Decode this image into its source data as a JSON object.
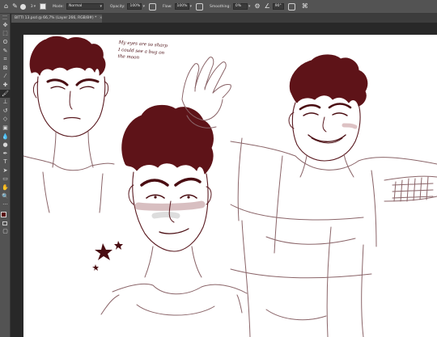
{
  "options_bar": {
    "brush_size": "3",
    "mode_label": "Mode:",
    "mode_value": "Normal",
    "opacity_label": "Opacity:",
    "opacity_value": "100%",
    "flow_label": "Flow:",
    "flow_value": "100%",
    "smoothing_label": "Smoothing:",
    "smoothing_value": "0%",
    "angle_value": "90°"
  },
  "document": {
    "tab_title": "BITTI 13.psd @ 66,7% (Layer 266, RGB/8#) *",
    "close_glyph": "×"
  },
  "toolbar": {
    "tools": [
      {
        "name": "move-tool-icon",
        "glyph": "✥"
      },
      {
        "name": "marquee-tool-icon",
        "glyph": "⬚"
      },
      {
        "name": "lasso-tool-icon",
        "glyph": "ʘ"
      },
      {
        "name": "quick-select-tool-icon",
        "glyph": "✎"
      },
      {
        "name": "crop-tool-icon",
        "glyph": "⌗"
      },
      {
        "name": "frame-tool-icon",
        "glyph": "⊠"
      },
      {
        "name": "eyedropper-tool-icon",
        "glyph": "⁄"
      },
      {
        "name": "healing-brush-tool-icon",
        "glyph": "✚"
      },
      {
        "name": "brush-tool-icon",
        "glyph": "🖌",
        "active": true
      },
      {
        "name": "clone-stamp-tool-icon",
        "glyph": "⊥"
      },
      {
        "name": "history-brush-tool-icon",
        "glyph": "↺"
      },
      {
        "name": "eraser-tool-icon",
        "glyph": "◇"
      },
      {
        "name": "gradient-tool-icon",
        "glyph": "▣"
      },
      {
        "name": "blur-tool-icon",
        "glyph": "💧"
      },
      {
        "name": "dodge-tool-icon",
        "glyph": "●"
      },
      {
        "name": "pen-tool-icon",
        "glyph": "✒"
      },
      {
        "name": "type-tool-icon",
        "glyph": "T"
      },
      {
        "name": "path-select-tool-icon",
        "glyph": "➤"
      },
      {
        "name": "rectangle-tool-icon",
        "glyph": "▭"
      },
      {
        "name": "hand-tool-icon",
        "glyph": "✋"
      },
      {
        "name": "zoom-tool-icon",
        "glyph": "🔍"
      },
      {
        "name": "more-tools-icon",
        "glyph": "···"
      }
    ],
    "foreground_color": "#5a0a0a",
    "background_color": "#ffffff"
  },
  "canvas": {
    "note_lines": [
      "My eyes are so sharp",
      "I could see a bug on",
      "the moon"
    ],
    "ink_color": "#4a0d12",
    "hair_color": "#5e1318",
    "sketch_color": "#8a6468"
  }
}
